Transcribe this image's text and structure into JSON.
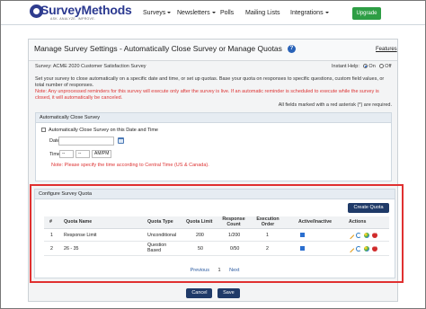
{
  "nav": {
    "logo_text": "SurveyMethods",
    "logo_tagline": "ASK. ANALYZE. IMPROVE.",
    "items": [
      "Surveys",
      "Newsletters",
      "Polls",
      "Mailing Lists",
      "Integrations"
    ],
    "upgrade": "Upgrade"
  },
  "page": {
    "title": "Manage Survey Settings - Automatically Close Survey or Manage Quotas",
    "features": "Features",
    "survey": "Survey: ACME 2020 Customer Satisfaction Survey",
    "instant_help": "Instant Help:",
    "on": "On",
    "off": "Off",
    "description": "Set your survey to close automatically on a specific date and time, or set up quotas. Base your quota on responses to specific questions, custom field values, or total number of responses.",
    "note": "Note: Any unprocessed reminders for this survey will execute only after the survey is live. If an automatic reminder is scheduled to execute while the survey is closed, it will automatically be canceled.",
    "required_note": "All fields marked with a red asterisk (*) are required."
  },
  "auto_close": {
    "header": "Automatically Close Survey",
    "checkbox_label": "Automatically Close Survey on this Date and Time",
    "date_label": "Date:",
    "time_label": "Time:",
    "hour": "--",
    "minute": "--",
    "ampm": "AM/PM",
    "note": "Note: Please specify the time according to Central Time (US & Canada)."
  },
  "quota": {
    "header": "Configure Survey Quota",
    "create_button": "Create Quota",
    "columns": [
      "#",
      "Quota Name",
      "Quota Type",
      "Quota Limit",
      "Response Count",
      "Execution Order",
      "Active/Inactive",
      "Actions"
    ],
    "rows": [
      {
        "num": "1",
        "name": "Response Limit",
        "type": "Unconditional",
        "limit": "200",
        "count": "1/200",
        "order": "1"
      },
      {
        "num": "2",
        "name": "26 - 35",
        "type": "Question Based",
        "limit": "50",
        "count": "0/50",
        "order": "2"
      }
    ],
    "pager": {
      "previous": "Previous",
      "current": "1",
      "next": "Next"
    }
  },
  "buttons": {
    "cancel": "Cancel",
    "save": "Save"
  }
}
